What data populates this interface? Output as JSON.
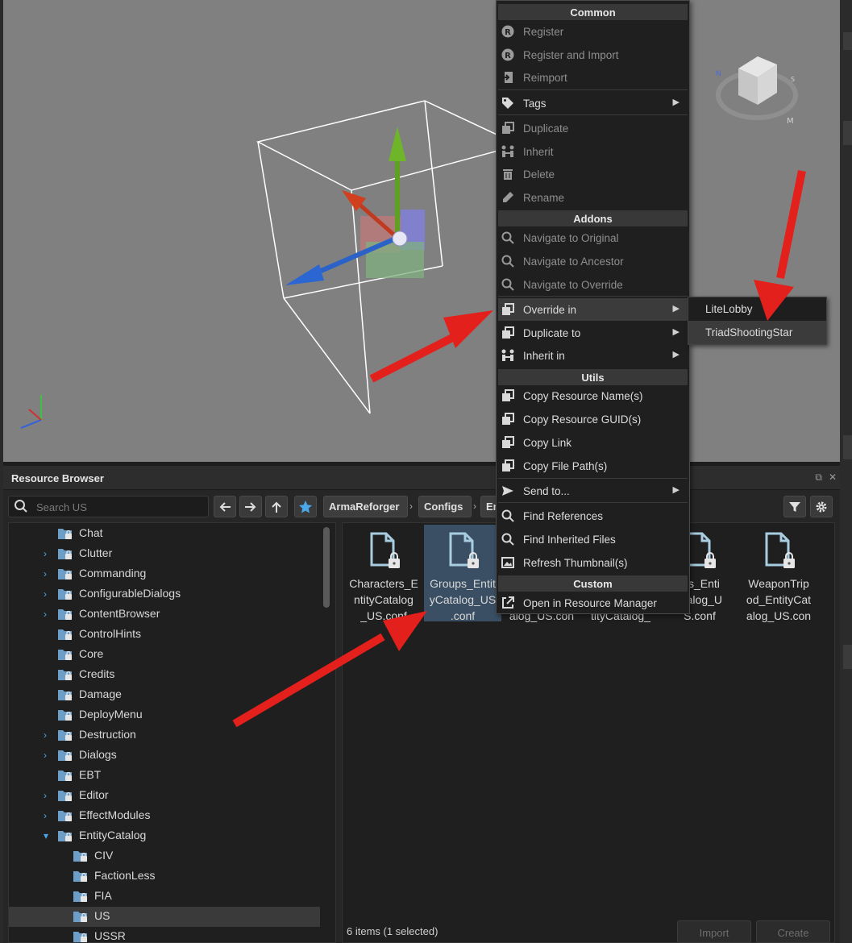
{
  "resource_browser": {
    "title": "Resource Browser",
    "search_placeholder": "Search US",
    "breadcrumbs": [
      "ArmaReforger",
      "Configs",
      "En"
    ],
    "status": "6 items (1 selected)",
    "import_label": "Import",
    "create_label": "Create"
  },
  "tree": {
    "items": [
      {
        "label": "Chat",
        "level": 1,
        "expand": "none"
      },
      {
        "label": "Clutter",
        "level": 1,
        "expand": "collapsed"
      },
      {
        "label": "Commanding",
        "level": 1,
        "expand": "collapsed"
      },
      {
        "label": "ConfigurableDialogs",
        "level": 1,
        "expand": "collapsed"
      },
      {
        "label": "ContentBrowser",
        "level": 1,
        "expand": "collapsed"
      },
      {
        "label": "ControlHints",
        "level": 1,
        "expand": "none"
      },
      {
        "label": "Core",
        "level": 1,
        "expand": "none"
      },
      {
        "label": "Credits",
        "level": 1,
        "expand": "none"
      },
      {
        "label": "Damage",
        "level": 1,
        "expand": "none"
      },
      {
        "label": "DeployMenu",
        "level": 1,
        "expand": "none"
      },
      {
        "label": "Destruction",
        "level": 1,
        "expand": "collapsed"
      },
      {
        "label": "Dialogs",
        "level": 1,
        "expand": "collapsed"
      },
      {
        "label": "EBT",
        "level": 1,
        "expand": "none"
      },
      {
        "label": "Editor",
        "level": 1,
        "expand": "collapsed"
      },
      {
        "label": "EffectModules",
        "level": 1,
        "expand": "collapsed"
      },
      {
        "label": "EntityCatalog",
        "level": 1,
        "expand": "expanded"
      },
      {
        "label": "CIV",
        "level": 2,
        "expand": "none"
      },
      {
        "label": "FactionLess",
        "level": 2,
        "expand": "none"
      },
      {
        "label": "FIA",
        "level": 2,
        "expand": "none"
      },
      {
        "label": "US",
        "level": 2,
        "expand": "none",
        "selected": true
      },
      {
        "label": "USSR",
        "level": 2,
        "expand": "none"
      }
    ]
  },
  "files": [
    {
      "name": "Characters_EntityCatalog_US.conf",
      "lines": [
        "Characters_E",
        "ntityCatalog",
        "_US.conf"
      ]
    },
    {
      "name": "Groups_EntityCatalog_US.conf",
      "lines": [
        "Groups_Entit",
        "yCatalog_US",
        ".conf"
      ],
      "selected": true
    },
    {
      "name": "…alog_US.con",
      "lines": [
        "",
        "",
        "alog_US.con"
      ]
    },
    {
      "name": "…ityCatalog_",
      "lines": [
        "",
        "",
        "tityCatalog_"
      ]
    },
    {
      "name": "…les_EntityCatalog_US.conf",
      "lines": [
        "les_Enti",
        "atalog_U",
        "S.conf"
      ]
    },
    {
      "name": "WeaponTripod_EntityCatalog_US.con",
      "lines": [
        "WeaponTrip",
        "od_EntityCat",
        "alog_US.con"
      ]
    }
  ],
  "context_menu": {
    "sections": {
      "common": "Common",
      "addons": "Addons",
      "utils": "Utils",
      "custom": "Custom"
    },
    "items": {
      "register": "Register",
      "register_import": "Register and Import",
      "reimport": "Reimport",
      "tags": "Tags",
      "duplicate": "Duplicate",
      "inherit": "Inherit",
      "delete": "Delete",
      "rename": "Rename",
      "nav_original": "Navigate to Original",
      "nav_ancestor": "Navigate to Ancestor",
      "nav_override": "Navigate to Override",
      "override_in": "Override in",
      "duplicate_to": "Duplicate to",
      "inherit_in": "Inherit in",
      "copy_name": "Copy Resource Name(s)",
      "copy_guid": "Copy Resource GUID(s)",
      "copy_link": "Copy Link",
      "copy_path": "Copy File Path(s)",
      "send_to": "Send to...",
      "find_refs": "Find References",
      "find_inherited": "Find Inherited Files",
      "refresh_thumb": "Refresh Thumbnail(s)",
      "open_rm": "Open in Resource Manager"
    }
  },
  "submenu": {
    "items": [
      "LiteLobby",
      "TriadShootingStar"
    ]
  },
  "colors": {
    "viewport_bg": "#808080",
    "annotation_arrow": "#e3201b",
    "selection_blue": "#3b4f64",
    "accent_blue": "#4aa8e8"
  }
}
